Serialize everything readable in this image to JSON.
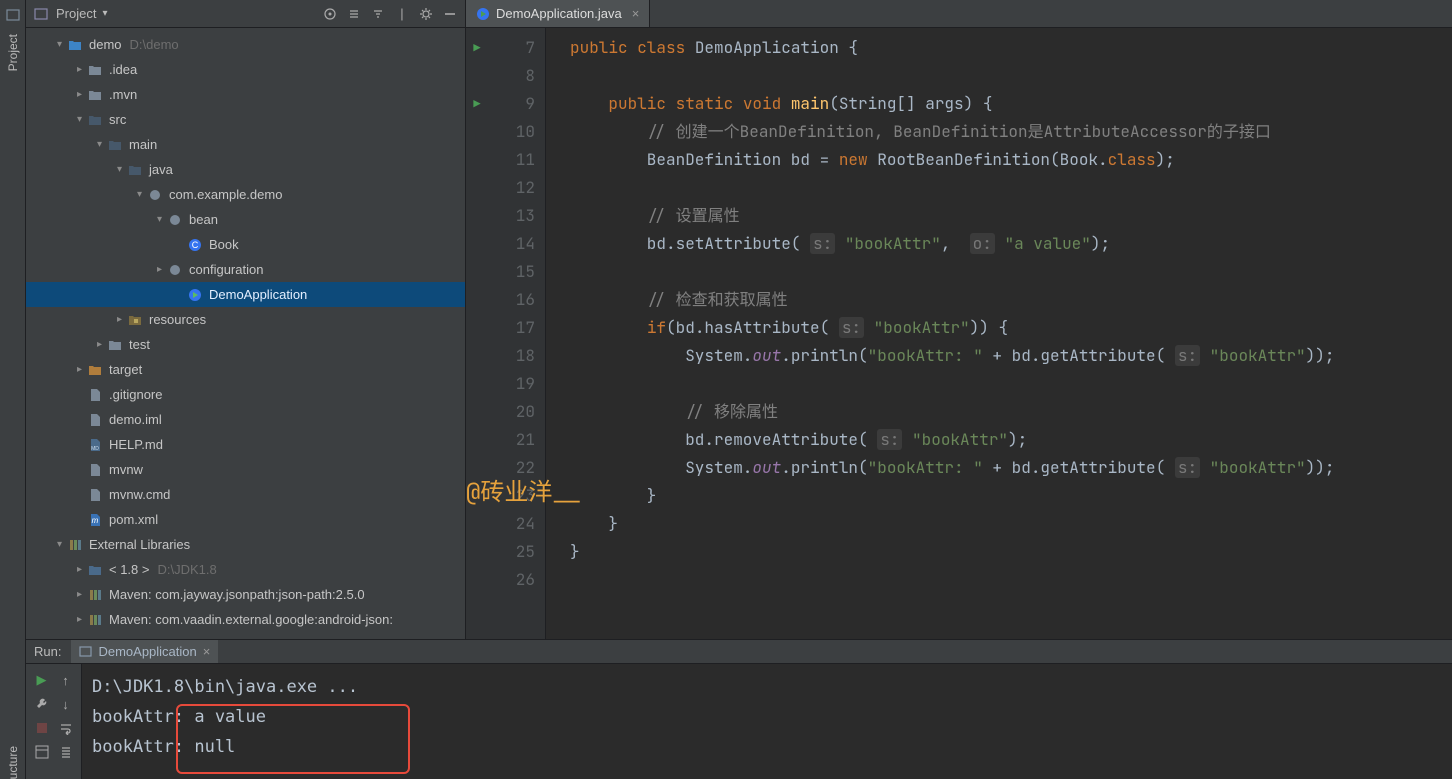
{
  "leftTabs": {
    "project": "Project",
    "structure": "ucture"
  },
  "sidebar": {
    "title": "Project",
    "tree": [
      {
        "d": 0,
        "tw": "v",
        "k": "folder-blue",
        "t": "demo",
        "hint": "D:\\demo"
      },
      {
        "d": 1,
        "tw": ">",
        "k": "folder",
        "t": ".idea"
      },
      {
        "d": 1,
        "tw": ">",
        "k": "folder",
        "t": ".mvn"
      },
      {
        "d": 1,
        "tw": "v",
        "k": "folder-src",
        "t": "src"
      },
      {
        "d": 2,
        "tw": "v",
        "k": "folder-src",
        "t": "main"
      },
      {
        "d": 3,
        "tw": "v",
        "k": "folder-src",
        "t": "java"
      },
      {
        "d": 4,
        "tw": "v",
        "k": "pkg",
        "t": "com.example.demo"
      },
      {
        "d": 5,
        "tw": "v",
        "k": "pkg",
        "t": "bean"
      },
      {
        "d": 6,
        "tw": "",
        "k": "class",
        "t": "Book"
      },
      {
        "d": 5,
        "tw": ">",
        "k": "pkg",
        "t": "configuration"
      },
      {
        "d": 6,
        "tw": "",
        "k": "class-run",
        "t": "DemoApplication",
        "sel": true
      },
      {
        "d": 3,
        "tw": ">",
        "k": "res",
        "t": "resources"
      },
      {
        "d": 2,
        "tw": ">",
        "k": "folder",
        "t": "test"
      },
      {
        "d": 1,
        "tw": ">",
        "k": "folder-orange",
        "t": "target"
      },
      {
        "d": 1,
        "tw": "",
        "k": "file",
        "t": ".gitignore"
      },
      {
        "d": 1,
        "tw": "",
        "k": "file",
        "t": "demo.iml"
      },
      {
        "d": 1,
        "tw": "",
        "k": "md",
        "t": "HELP.md"
      },
      {
        "d": 1,
        "tw": "",
        "k": "file",
        "t": "mvnw"
      },
      {
        "d": 1,
        "tw": "",
        "k": "file",
        "t": "mvnw.cmd"
      },
      {
        "d": 1,
        "tw": "",
        "k": "mvn",
        "t": "pom.xml"
      },
      {
        "d": 0,
        "tw": "v",
        "k": "lib",
        "t": "External Libraries"
      },
      {
        "d": 1,
        "tw": ">",
        "k": "jdk",
        "t": "< 1.8 >",
        "hint": "D:\\JDK1.8"
      },
      {
        "d": 1,
        "tw": ">",
        "k": "lib",
        "t": "Maven: com.jayway.jsonpath:json-path:2.5.0"
      },
      {
        "d": 1,
        "tw": ">",
        "k": "lib",
        "t": "Maven: com.vaadin.external.google:android-json:"
      }
    ]
  },
  "editor": {
    "tab": "DemoApplication.java",
    "firstLine": 7,
    "runMarkers": [
      7,
      9
    ],
    "lines": [
      [
        [
          "kw",
          "public "
        ],
        [
          "kw",
          "class "
        ],
        [
          "typ",
          "DemoApplication "
        ],
        [
          "id",
          "{"
        ]
      ],
      [],
      [
        [
          "id",
          "    "
        ],
        [
          "kw",
          "public "
        ],
        [
          "kw",
          "static "
        ],
        [
          "kw",
          "void "
        ],
        [
          "mth",
          "main"
        ],
        [
          "id",
          "(String[] args) {"
        ]
      ],
      [
        [
          "id",
          "        "
        ],
        [
          "cm",
          "// 创建一个BeanDefinition, BeanDefinition是AttributeAccessor的子接口"
        ]
      ],
      [
        [
          "id",
          "        BeanDefinition bd = "
        ],
        [
          "kw",
          "new "
        ],
        [
          "id",
          "RootBeanDefinition(Book."
        ],
        [
          "kw",
          "class"
        ],
        [
          "id",
          ");"
        ]
      ],
      [],
      [
        [
          "id",
          "        "
        ],
        [
          "cm",
          "// 设置属性"
        ]
      ],
      [
        [
          "id",
          "        bd.setAttribute( "
        ],
        [
          "hint2",
          "s:"
        ],
        [
          "id",
          " "
        ],
        [
          "str",
          "\"bookAttr\""
        ],
        [
          "id",
          ",  "
        ],
        [
          "hint2",
          "o:"
        ],
        [
          "id",
          " "
        ],
        [
          "str",
          "\"a value\""
        ],
        [
          "id",
          ");"
        ]
      ],
      [],
      [
        [
          "id",
          "        "
        ],
        [
          "cm",
          "// 检查和获取属性"
        ]
      ],
      [
        [
          "id",
          "        "
        ],
        [
          "kw",
          "if"
        ],
        [
          "id",
          "(bd.hasAttribute( "
        ],
        [
          "hint2",
          "s:"
        ],
        [
          "id",
          " "
        ],
        [
          "str",
          "\"bookAttr\""
        ],
        [
          "id",
          ")) {"
        ]
      ],
      [
        [
          "id",
          "            System."
        ],
        [
          "fld",
          "out"
        ],
        [
          "id",
          ".println("
        ],
        [
          "str",
          "\"bookAttr: \""
        ],
        [
          "id",
          " + bd.getAttribute( "
        ],
        [
          "hint2",
          "s:"
        ],
        [
          "id",
          " "
        ],
        [
          "str",
          "\"bookAttr\""
        ],
        [
          "id",
          "));"
        ]
      ],
      [],
      [
        [
          "id",
          "            "
        ],
        [
          "cm",
          "// 移除属性"
        ]
      ],
      [
        [
          "id",
          "            bd.removeAttribute( "
        ],
        [
          "hint2",
          "s:"
        ],
        [
          "id",
          " "
        ],
        [
          "str",
          "\"bookAttr\""
        ],
        [
          "id",
          ");"
        ]
      ],
      [
        [
          "id",
          "            System."
        ],
        [
          "fld",
          "out"
        ],
        [
          "id",
          ".println("
        ],
        [
          "str",
          "\"bookAttr: \""
        ],
        [
          "id",
          " + bd.getAttribute( "
        ],
        [
          "hint2",
          "s:"
        ],
        [
          "id",
          " "
        ],
        [
          "str",
          "\"bookAttr\""
        ],
        [
          "id",
          "));"
        ]
      ],
      [
        [
          "id",
          "        }"
        ]
      ],
      [
        [
          "id",
          "    }"
        ]
      ],
      [
        [
          "id",
          "}"
        ]
      ],
      []
    ]
  },
  "watermark": "@砖业洋__",
  "run": {
    "label": "Run:",
    "tab": "DemoApplication",
    "lines": [
      "D:\\JDK1.8\\bin\\java.exe ...",
      "bookAttr: a value",
      "bookAttr: null"
    ]
  }
}
